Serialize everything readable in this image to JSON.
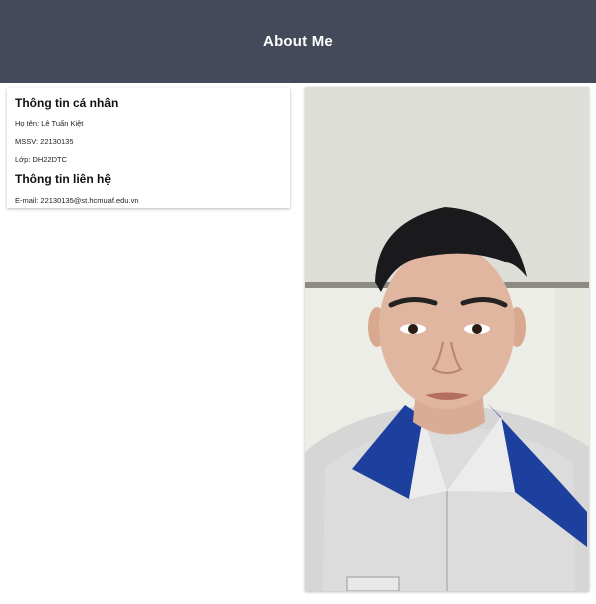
{
  "header": {
    "title": "About Me"
  },
  "personal": {
    "heading": "Thông tin cá nhân",
    "name_line": "Họ tên: Lê Tuấn Kiệt",
    "id_line": "MSSV: 22130135",
    "class_line": "Lớp: DH22DTC"
  },
  "contact": {
    "heading": "Thông tin liên hệ",
    "email_line": "E-mail: 22130135@st.hcmuaf.edu.vn"
  }
}
